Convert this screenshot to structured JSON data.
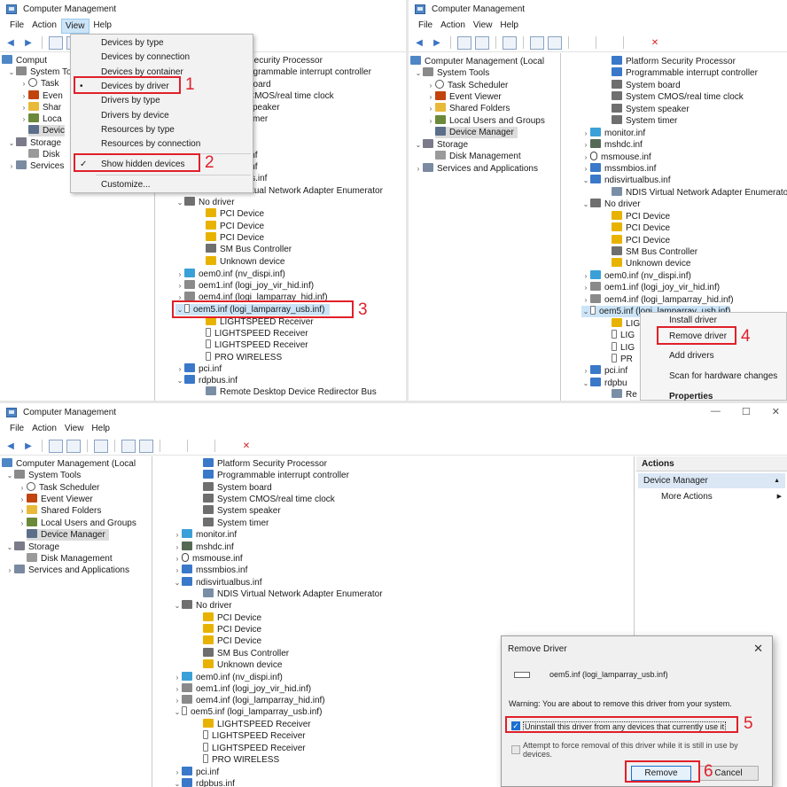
{
  "app_title": "Computer Management",
  "menu": [
    "File",
    "Action",
    "View",
    "Help"
  ],
  "console_tree": {
    "root": "Computer Management (Local",
    "system_tools": "System Tools",
    "task_scheduler": "Task Scheduler",
    "event_viewer": "Event Viewer",
    "shared_folders": "Shared Folders",
    "local_users": "Local Users and Groups",
    "device_manager": "Device Manager",
    "storage": "Storage",
    "disk_management": "Disk Management",
    "services": "Services and Applications"
  },
  "panel1_tree_partial": {
    "task": "Task",
    "event": "Even",
    "shared": "Shar",
    "local": "Loca",
    "device": "Devic",
    "storage": "Storage",
    "disk": "Disk",
    "services": "Services",
    "root": "Comput"
  },
  "devices": {
    "platform_security": "Platform Security Processor",
    "programmable_interrupt": "Programmable interrupt controller",
    "system_board": "System board",
    "system_cmos": "System CMOS/real time clock",
    "system_speaker": "System speaker",
    "system_timer": "System timer",
    "monitor_inf": "monitor.inf",
    "mshdc_inf": "mshdc.inf",
    "msmouse_inf": "msmouse.inf",
    "mssmbios_inf": "mssmbios.inf",
    "ndisvirtualbus_inf": "ndisvirtualbus.inf",
    "ndis_enum": "NDIS Virtual Network Adapter Enumerator",
    "no_driver": "No driver",
    "pci_device": "PCI Device",
    "sm_bus": "SM Bus Controller",
    "unknown_device": "Unknown device",
    "oem0": "oem0.inf (nv_dispi.inf)",
    "oem1": "oem1.inf (logi_joy_vir_hid.inf)",
    "oem4": "oem4.inf (logi_lamparray_hid.inf)",
    "oem5": "oem5.inf (logi_lamparray_usb.inf)",
    "lightspeed": "LIGHTSPEED Receiver",
    "pro_wireless": "PRO WIRELESS",
    "pci_inf": "pci.inf",
    "rdpbus_inf": "rdpbus.inf",
    "rdp_redirector": "Remote Desktop Device Redirector Bus"
  },
  "panel1_partial": {
    "security_processor": "Security Processor",
    "programmable": "ogrammable interrupt controller",
    "board": "board",
    "cmos": "CMOS/real time clock",
    "speaker": "speaker",
    "timer": "timer",
    "inf1": "inf",
    "inf2": "inf",
    "bus": "bus.inf",
    "virtual_net": "Virtual Network Adapter Enumerator"
  },
  "panel2_partial": {
    "oem5_cut": "oem5.inf (logi_lamparray_usb.inf)",
    "li1": "LIG",
    "li2": "LIG",
    "li3": "LIG",
    "pr": "PR",
    "pci": "pci.inf",
    "rdpbu": "rdpbu",
    "re": "Re"
  },
  "view_menu": {
    "items": [
      "Devices by type",
      "Devices by connection",
      "Devices by container",
      "Devices by driver",
      "Drivers by type",
      "Drivers by device",
      "Resources by type",
      "Resources by connection",
      "Show hidden devices",
      "Customize..."
    ],
    "bullet": "•",
    "check": "✓"
  },
  "context_menu": {
    "items": [
      "Install driver",
      "Remove driver",
      "Add drivers",
      "Scan for hardware changes",
      "Properties"
    ]
  },
  "actions_pane": {
    "title": "Actions",
    "section": "Device Manager",
    "more": "More Actions"
  },
  "remove_dialog": {
    "title": "Remove Driver",
    "driver_name": "oem5.inf (logi_lamparray_usb.inf)",
    "warning": "Warning: You are about to remove this driver from your system.",
    "option_uninstall": "Uninstall this driver from any devices that currently use it",
    "option_force_line1": "Attempt to force removal of this driver while it is still in use by",
    "option_force_line2": "devices.",
    "remove_button": "Remove",
    "cancel_button": "Cancel",
    "uninstall_checked": true,
    "force_checked": false
  },
  "steps": [
    "1",
    "2",
    "3",
    "4",
    "5",
    "6"
  ],
  "window_controls": {
    "minimize": "—",
    "maximize": "☐",
    "close": "✕"
  },
  "glyphs": {
    "expanded": "⌄",
    "collapsed": "›",
    "caret_left": "◀",
    "caret_right": "▶",
    "submenu": "▶",
    "close": "✕",
    "back": "◀",
    "forward": "▶"
  },
  "colors": {
    "callout_red": "#e0202a",
    "selection_blue": "#cce4f7",
    "checkbox_blue": "#1c6fd1"
  }
}
